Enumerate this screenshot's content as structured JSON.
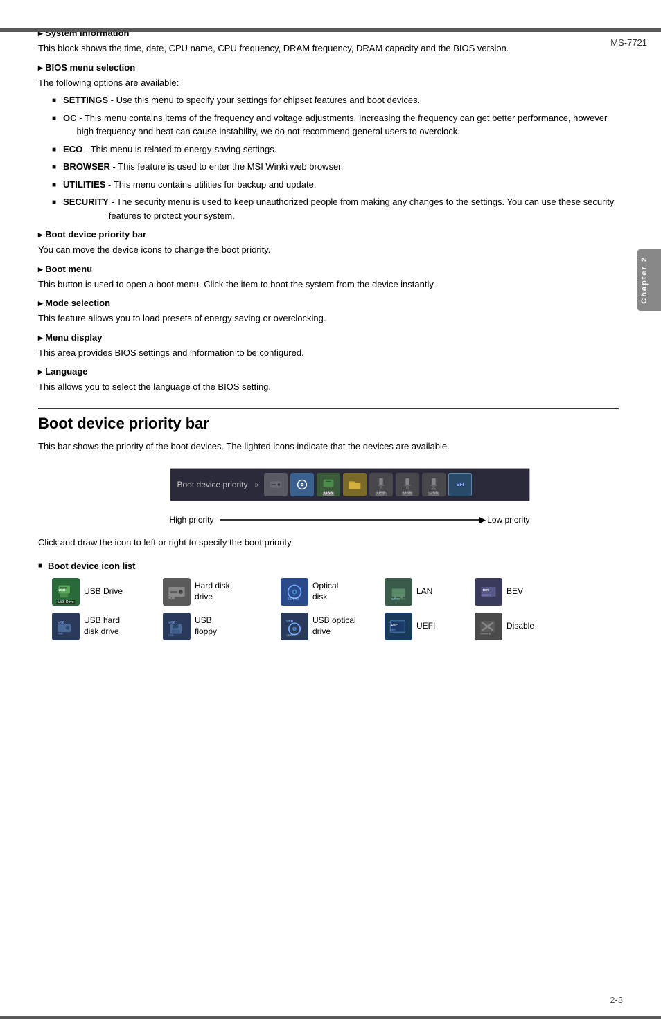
{
  "header": {
    "model": "MS-7721",
    "chapter_label": "Chapter 2"
  },
  "sections": [
    {
      "id": "system-info",
      "heading": "System information",
      "body": "This block shows the time, date, CPU name, CPU frequency, DRAM frequency, DRAM capacity and the BIOS version."
    },
    {
      "id": "bios-menu-selection",
      "heading": "BIOS menu selection",
      "intro": "The following options are available:",
      "items": [
        {
          "bold": "SETTINGS",
          "text": " - Use this menu to specify your settings for chipset features and boot devices."
        },
        {
          "bold": "OC",
          "text": " - This menu contains items of the frequency and voltage adjustments. Increasing the frequency can get better performance, however high frequency and heat can cause instability, we do not recommend general users to overclock."
        },
        {
          "bold": "ECO",
          "text": " - This menu is related to energy-saving settings."
        },
        {
          "bold": "BROWSER",
          "text": " - This feature is used to enter the MSI Winki web browser."
        },
        {
          "bold": "UTILITIES",
          "text": " - This menu contains utilities for backup and update."
        },
        {
          "bold": "SECURITY",
          "text": " - The security menu is used to keep unauthorized people from making any changes to the settings. You can use these security features to protect your system."
        }
      ]
    },
    {
      "id": "boot-device-priority-bar",
      "heading": "Boot device priority bar",
      "body": "You can move the device icons to change the boot priority."
    },
    {
      "id": "boot-menu",
      "heading": "Boot menu",
      "body": "This button is used to open a boot menu. Click the item to boot the system from the device instantly."
    },
    {
      "id": "mode-selection",
      "heading": "Mode selection",
      "body": "This feature allows you to load presets of energy saving or overclocking."
    },
    {
      "id": "menu-display",
      "heading": "Menu display",
      "body": "This area provides BIOS settings and information to be configured."
    },
    {
      "id": "language",
      "heading": "Language",
      "body": "This allows you to select the language of the BIOS setting."
    }
  ],
  "boot_section": {
    "title": "Boot device priority bar",
    "description": "This bar shows the priority of the boot devices. The lighted icons indicate that the devices are available.",
    "priority_bar": {
      "label": "Boot device priority",
      "arrows": "»",
      "high_priority": "High priority",
      "low_priority": "Low priority"
    },
    "click_instruction": "Click and draw the icon to left or right to specify the boot priority.",
    "icon_list_heading": "Boot device icon list",
    "icons": [
      {
        "name": "USB Drive",
        "type": "usb-drive"
      },
      {
        "name": "Hard disk\ndrive",
        "type": "hard-disk"
      },
      {
        "name": "Optical\ndisk",
        "type": "optical"
      },
      {
        "name": "LAN",
        "type": "lan"
      },
      {
        "name": "BEV",
        "type": "bev"
      },
      {
        "name": "USB hard\ndisk drive",
        "type": "usb-hdd"
      },
      {
        "name": "USB\nfloppy",
        "type": "usb-floppy"
      },
      {
        "name": "USB optical\ndrive",
        "type": "usb-optical"
      },
      {
        "name": "UEFI",
        "type": "uefi"
      },
      {
        "name": "Disable",
        "type": "disable"
      }
    ]
  },
  "page_number": "2-3"
}
